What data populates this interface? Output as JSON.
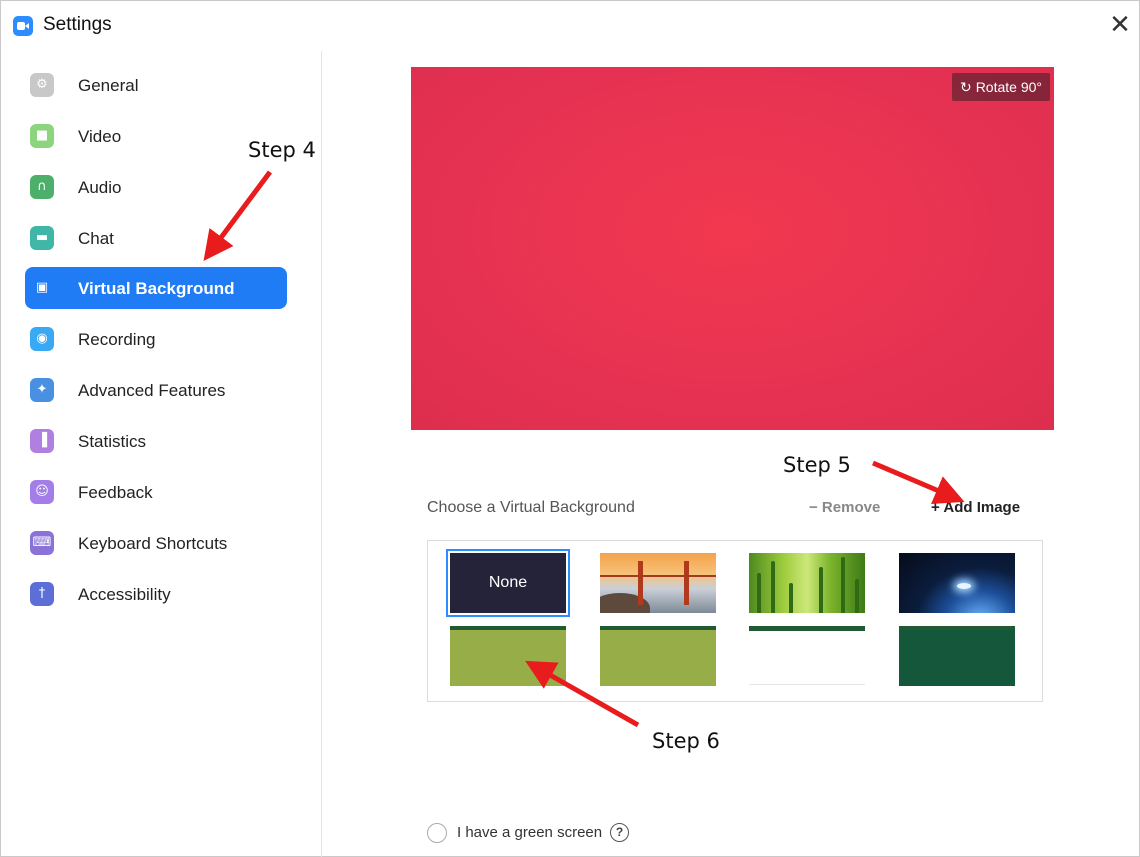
{
  "window": {
    "title": "Settings",
    "close_glyph": "✕"
  },
  "sidebar": {
    "items": [
      {
        "label": "General",
        "icon": "gear-icon",
        "color": "#c8c8c8",
        "glyph": "⚙"
      },
      {
        "label": "Video",
        "icon": "video-camera-icon",
        "color": "#8cd47e",
        "glyph": "■"
      },
      {
        "label": "Audio",
        "icon": "headphones-icon",
        "color": "#4caf6a",
        "glyph": "∩"
      },
      {
        "label": "Chat",
        "icon": "chat-bubble-icon",
        "color": "#3fb6a8",
        "glyph": "▬"
      },
      {
        "label": "Virtual Background",
        "icon": "person-card-icon",
        "color": "#1f7cf5",
        "glyph": "▣",
        "active": true
      },
      {
        "label": "Recording",
        "icon": "record-icon",
        "color": "#3aa9f5",
        "glyph": "◉"
      },
      {
        "label": "Advanced Features",
        "icon": "sparkle-icon",
        "color": "#4a90e2",
        "glyph": "✦"
      },
      {
        "label": "Statistics",
        "icon": "bar-chart-icon",
        "color": "#b07fe0",
        "glyph": "▐"
      },
      {
        "label": "Feedback",
        "icon": "smiley-icon",
        "color": "#a37ee8",
        "glyph": "☺"
      },
      {
        "label": "Keyboard Shortcuts",
        "icon": "keyboard-icon",
        "color": "#8a72d8",
        "glyph": "⌨"
      },
      {
        "label": "Accessibility",
        "icon": "accessibility-icon",
        "color": "#5b6fd6",
        "glyph": "†"
      }
    ]
  },
  "preview": {
    "rotate_label": "Rotate 90°",
    "rotate_glyph": "↻",
    "color": "#ea3450"
  },
  "backgrounds": {
    "heading": "Choose a Virtual Background",
    "remove_label": "− Remove",
    "add_label": "+ Add Image",
    "none_label": "None",
    "selected": "None"
  },
  "green_screen": {
    "label": "I have a green screen",
    "help_glyph": "?"
  },
  "annotations": {
    "step4": "Step 4",
    "step5": "Step 5",
    "step6": "Step 6",
    "arrow_color": "#e81c1c"
  }
}
